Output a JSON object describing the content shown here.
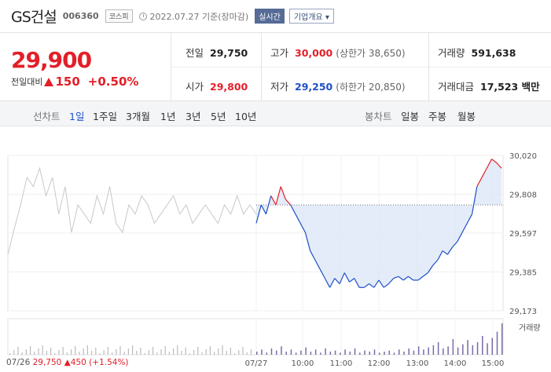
{
  "stock": {
    "name": "GS건설",
    "code": "006360",
    "market": "코스피",
    "datetime": "2022.07.27 기준(장마감)",
    "live_label": "실시간",
    "corp_label": "기업개요"
  },
  "price": {
    "current": "29,900",
    "change_label": "전일대비",
    "change": "150",
    "change_pct": "+0.50%"
  },
  "stats": {
    "prev_label": "전일",
    "prev": "29,750",
    "high_label": "고가",
    "high": "30,000",
    "upper_label": "(상한가 38,650)",
    "volume_label": "거래량",
    "volume": "591,638",
    "open_label": "시가",
    "open": "29,800",
    "low_label": "저가",
    "low": "29,250",
    "lower_label": "(하한가 20,850)",
    "amount_label": "거래대금",
    "amount": "17,523 백만"
  },
  "tabs": {
    "line_label": "선차트",
    "line": [
      "1일",
      "1주일",
      "3개월",
      "1년",
      "3년",
      "5년",
      "10년"
    ],
    "candle_label": "봉차트",
    "candle": [
      "일봉",
      "주봉",
      "월봉"
    ]
  },
  "colors": {
    "up": "#e31f28",
    "down": "#1e4fc7",
    "history": "#c8c8c8",
    "fill": "#dce7f6"
  },
  "chart_data": {
    "type": "line",
    "y_ticks": [
      "30,020",
      "29,808",
      "29,597",
      "29,385",
      "29,173"
    ],
    "ylim": [
      29173,
      30020
    ],
    "baseline": 29750,
    "x_ticks": [
      "07/27",
      "10:00",
      "11:00",
      "12:00",
      "13:00",
      "14:00",
      "15:00"
    ],
    "volume_label": "거래량",
    "prev_day": {
      "date": "07/26",
      "price": "29,750",
      "change": "▲450",
      "pct": "(+1.54%)"
    },
    "history_values": [
      29480,
      29620,
      29750,
      29900,
      29850,
      29950,
      29800,
      29900,
      29700,
      29850,
      29600,
      29750,
      29700,
      29650,
      29800,
      29700,
      29850,
      29650,
      29600,
      29750,
      29700,
      29800,
      29750,
      29650,
      29700,
      29750,
      29800,
      29700,
      29750,
      29650,
      29700,
      29750,
      29700,
      29650,
      29750,
      29700,
      29800,
      29700,
      29750,
      29700
    ],
    "today_values": [
      29650,
      29750,
      29700,
      29800,
      29750,
      29850,
      29780,
      29750,
      29700,
      29650,
      29600,
      29500,
      29450,
      29400,
      29350,
      29300,
      29350,
      29320,
      29380,
      29330,
      29350,
      29300,
      29300,
      29320,
      29300,
      29340,
      29300,
      29320,
      29350,
      29360,
      29340,
      29360,
      29340,
      29340,
      29360,
      29380,
      29420,
      29450,
      29500,
      29480,
      29520,
      29550,
      29600,
      29650,
      29700,
      29850,
      29900,
      29950,
      30000,
      29980,
      29950
    ],
    "volumes": [
      3,
      5,
      2,
      6,
      4,
      8,
      3,
      5,
      2,
      4,
      7,
      3,
      5,
      2,
      6,
      3,
      4,
      2,
      5,
      3,
      6,
      2,
      4,
      3,
      5,
      2,
      3,
      4,
      2,
      5,
      3,
      6,
      4,
      8,
      5,
      7,
      9,
      12,
      6,
      8,
      15,
      7,
      10,
      14,
      9,
      12,
      18,
      11,
      16,
      22,
      30
    ]
  }
}
